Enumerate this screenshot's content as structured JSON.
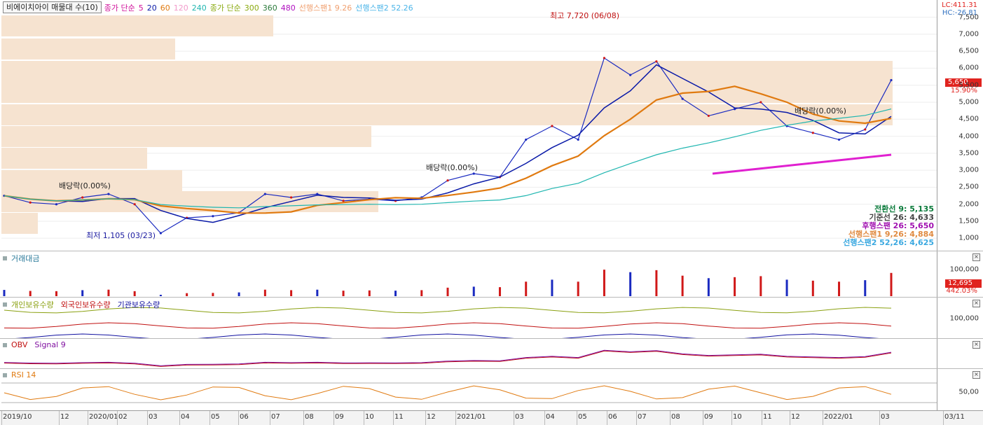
{
  "price_panel": {
    "title": "비에이치아이 매물대 수(10)",
    "legend": [
      {
        "label": "종가 단순",
        "color": "#d0109a"
      },
      {
        "label": "5",
        "color": "#d0109a"
      },
      {
        "label": "20",
        "color": "#0a1aa8"
      },
      {
        "label": "60",
        "color": "#e07a10"
      },
      {
        "label": "120",
        "color": "#f29acb"
      },
      {
        "label": "240",
        "color": "#1fb6b0"
      },
      {
        "label": "종가 단순",
        "color": "#8aaa10"
      },
      {
        "label": "300",
        "color": "#8aaa10"
      },
      {
        "label": "360",
        "color": "#2a7a3a"
      },
      {
        "label": "480",
        "color": "#b010c0"
      },
      {
        "label": "선행스팬1 9.26",
        "color": "#f0a070"
      },
      {
        "label": "선행스팬2 52.26",
        "color": "#4ab4e8"
      }
    ],
    "y_ticks": [
      "7,500",
      "7,000",
      "6,500",
      "6,000",
      "5,500",
      "5,000",
      "4,500",
      "4,000",
      "3,500",
      "3,000",
      "2,500",
      "2,000",
      "1,500",
      "1,000"
    ],
    "lc": "LC:411.31",
    "hc": "HC:-26.81",
    "current_price": "5,650",
    "current_pct": "15.90%",
    "annotations": {
      "high": "최고 7,720 (06/08)",
      "low": "최저 1,105 (03/23)",
      "div1": "배당락(0.00%)",
      "div2": "배당락(0.00%)",
      "div3": "배당락(0.00%)"
    },
    "info_lines": [
      {
        "text": "전환선  9: 5,135",
        "color": "#0a7a3a"
      },
      {
        "text": "기준선 26: 4,633",
        "color": "#444444"
      },
      {
        "text": "후행스팬 26: 5,650",
        "color": "#a010b0"
      },
      {
        "text": "선행스팬1 9,26: 4,884",
        "color": "#e08a40"
      },
      {
        "text": "선행스팬2 52,26: 4,625",
        "color": "#3aa8e0"
      }
    ]
  },
  "volume_panel": {
    "title": "거래대금",
    "y_ticks": [
      "100,000"
    ],
    "current_value": "12,695",
    "current_pct": "442.03%"
  },
  "holdings_panel": {
    "legend": [
      {
        "label": "개인보유수량",
        "color": "#8aa010"
      },
      {
        "label": "외국인보유수량",
        "color": "#c01010"
      },
      {
        "label": "기관보유수량",
        "color": "#1010a0"
      }
    ],
    "y_ticks": [
      "100,000"
    ]
  },
  "obv_panel": {
    "legend": [
      {
        "label": "OBV",
        "color": "#c01010"
      },
      {
        "label": "Signal 9",
        "color": "#8010a0"
      }
    ]
  },
  "rsi_panel": {
    "legend": [
      {
        "label": "RSI 14",
        "color": "#e07a10"
      }
    ],
    "y_ticks": [
      "50,00"
    ]
  },
  "x_axis": {
    "labels": [
      "2019/10",
      "12",
      "2020/01",
      "02",
      "03",
      "04",
      "05",
      "06",
      "07",
      "08",
      "09",
      "10",
      "11",
      "12",
      "2021/01",
      "03",
      "04",
      "05",
      "06",
      "07",
      "08",
      "09",
      "10",
      "11",
      "12",
      "2022/01",
      "03",
      "03/11"
    ]
  },
  "chart_data": {
    "type": "line",
    "title": "비에이치아이 매물대 수(10)",
    "x_range": [
      "2019/10",
      "2022/03/11"
    ],
    "y_range": [
      800,
      7800
    ],
    "high": {
      "value": 7720,
      "date": "06/08"
    },
    "low": {
      "value": 1105,
      "date": "03/23"
    },
    "last_close": 5650,
    "last_change_pct": 15.9,
    "x": [
      0,
      2,
      4,
      6,
      8,
      10,
      12,
      14,
      16,
      18,
      20,
      22,
      24,
      26,
      28,
      30,
      32,
      34,
      36,
      38,
      40,
      42,
      44,
      46,
      48,
      50,
      52,
      54,
      56,
      58,
      60,
      62,
      64,
      66,
      68
    ],
    "series": [
      {
        "name": "종가",
        "values": [
          2250,
          2050,
          2000,
          2200,
          2300,
          2000,
          1150,
          1600,
          1650,
          1750,
          2300,
          2200,
          2300,
          2100,
          2150,
          2100,
          2200,
          2700,
          2900,
          2800,
          3900,
          4300,
          3900,
          6300,
          5800,
          6200,
          5100,
          4600,
          4800,
          5000,
          4300,
          4100,
          3900,
          4200,
          5650
        ]
      }
    ],
    "volume_bars_note": "거래대금",
    "indicators": {
      "전환선 9": 5135,
      "기준선 26": 4633,
      "후행스팬 26": 5650,
      "선행스팬1 9,26": 4884,
      "선행스팬2 52,26": 4625
    }
  }
}
